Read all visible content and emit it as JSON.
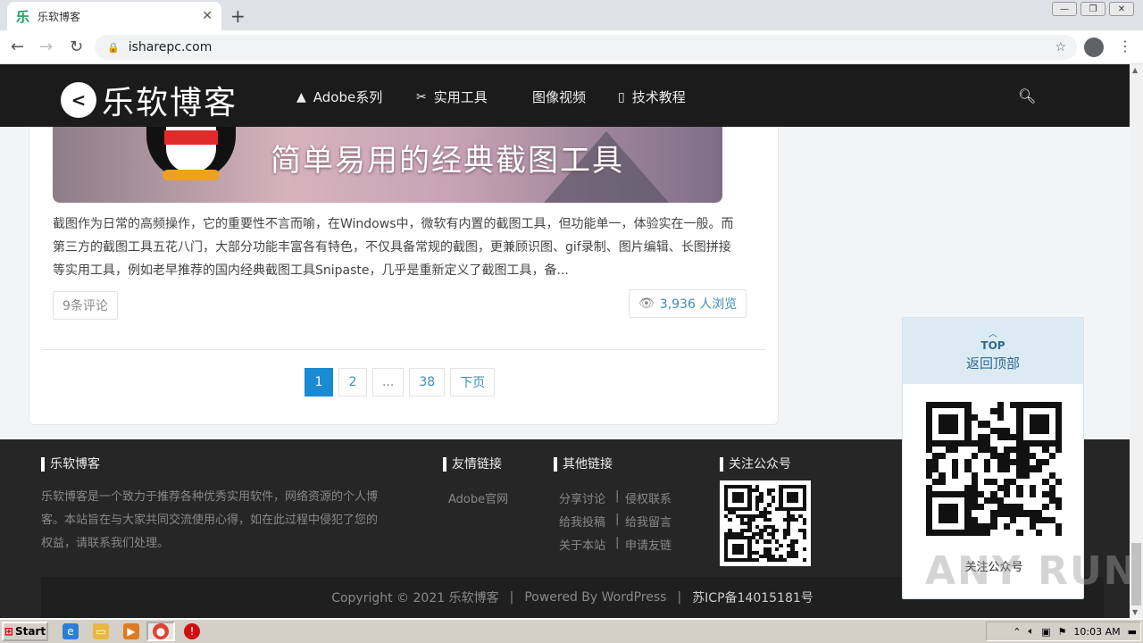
{
  "browser": {
    "tab_title": "乐软博客",
    "tab_favicon": "乐",
    "new_tab": "+",
    "tab_close": "✕",
    "url": "isharepc.com"
  },
  "site": {
    "logo_text": "乐软博客",
    "nav": [
      {
        "label": "Adobe系列",
        "icon": "adobe-icon"
      },
      {
        "label": "实用工具",
        "icon": "tools-icon"
      },
      {
        "label": "图像视频",
        "icon": "image-icon"
      },
      {
        "label": "技术教程",
        "icon": "book-icon"
      }
    ]
  },
  "article": {
    "banner_text": "简单易用的经典截图工具",
    "excerpt": "截图作为日常的高频操作，它的重要性不言而喻，在Windows中，微软有内置的截图工具，但功能单一，体验实在一般。而第三方的截图工具五花八门，大部分功能丰富各有特色，不仅具备常规的截图，更兼顾识图、gif录制、图片编辑、长图拼接等实用工具，例如老早推荐的国内经典截图工具Snipaste，几乎是重新定义了截图工具，备...",
    "comments": "9条评论",
    "views": "3,936 人浏览"
  },
  "pagination": {
    "pages": [
      "1",
      "2",
      "...",
      "38"
    ],
    "current": "1",
    "next": "下页"
  },
  "footer": {
    "about_title": "乐软博客",
    "about_text": "乐软博客是一个致力于推荐各种优秀实用软件，网络资源的个人博客。本站旨在与大家共同交流使用心得，如在此过程中侵犯了您的权益，请联系我们处理。",
    "friends_title": "友情链接",
    "friends_link": "Adobe官网",
    "other_title": "其他链接",
    "other_links": [
      [
        "分享讨论",
        "侵权联系"
      ],
      [
        "给我投稿",
        "给我留言"
      ],
      [
        "关于本站",
        "申请友链"
      ]
    ],
    "separator": "|",
    "follow_title": "关注公众号",
    "copyright": "Copyright © 2021 乐软博客",
    "powered": "Powered By WordPress",
    "icp": "苏ICP备14015181号"
  },
  "float_widget": {
    "top_label": "TOP",
    "back_to_top": "返回顶部",
    "follow_caption": "关注公众号"
  },
  "taskbar": {
    "start": "Start",
    "clock": "10:03 AM"
  },
  "watermark": "ANY RUN",
  "colors": {
    "header_bg": "#1b1b1b",
    "accent": "#1a8ad3",
    "link": "#3c8dbc",
    "footer_bg": "#262626"
  }
}
